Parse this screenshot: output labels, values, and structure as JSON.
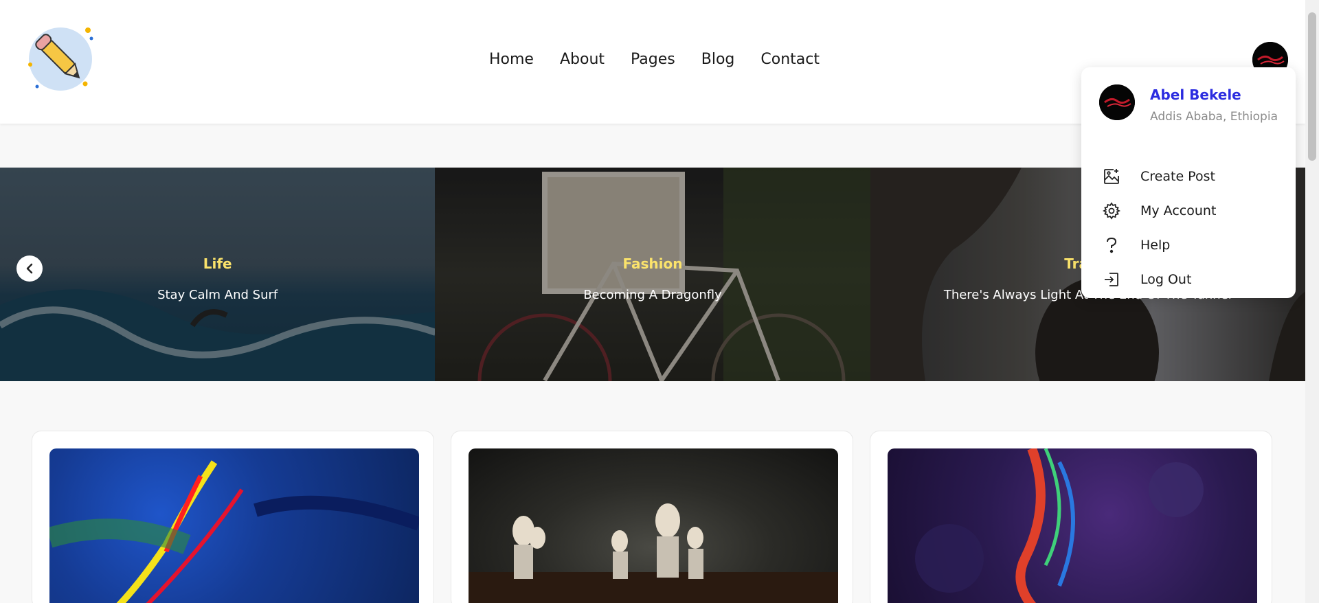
{
  "nav": {
    "items": [
      {
        "label": "Home"
      },
      {
        "label": "About"
      },
      {
        "label": "Pages"
      },
      {
        "label": "Blog"
      },
      {
        "label": "Contact"
      }
    ]
  },
  "carousel": {
    "slides": [
      {
        "category": "Life",
        "title": "Stay Calm And Surf"
      },
      {
        "category": "Fashion",
        "title": "Becoming A Dragonfly"
      },
      {
        "category": "Travel",
        "title": "There's Always Light At The End Of The Tunnel"
      }
    ]
  },
  "user_menu": {
    "name": "Abel Bekele",
    "location": "Addis Ababa, Ethiopia",
    "items": [
      {
        "label": "Create Post",
        "icon": "image-plus-icon"
      },
      {
        "label": "My Account",
        "icon": "gear-icon"
      },
      {
        "label": "Help",
        "icon": "question-icon"
      },
      {
        "label": "Log Out",
        "icon": "logout-icon"
      }
    ]
  },
  "colors": {
    "accent_name": "#2b2ce0",
    "category_yellow": "#fbe36b"
  }
}
